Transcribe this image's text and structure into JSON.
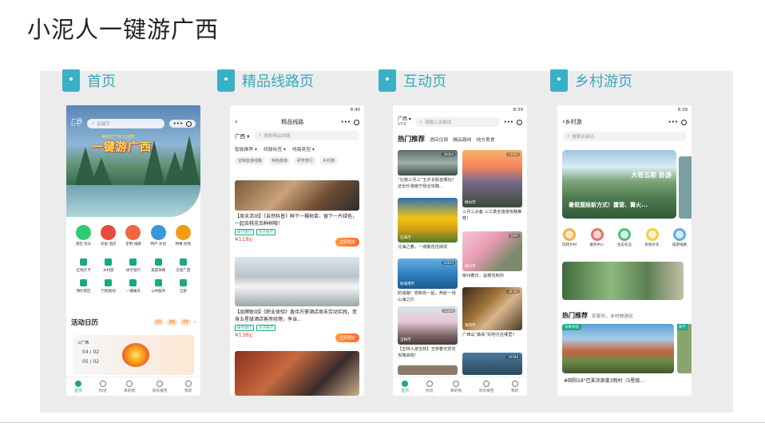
{
  "slide_title": "小泥人一键游广西",
  "section_labels": [
    "首页",
    "精品线路页",
    "互动页",
    "乡村游页"
  ],
  "status_bar": {
    "p2_time": "8:40",
    "p3_time": "8:39",
    "p4_time": "8:39"
  },
  "tabbar": [
    "首页",
    "附近",
    "目的地",
    "资讯报告",
    "我的"
  ],
  "home": {
    "city": "广西",
    "temp": "17°C",
    "search_placeholder": "关键字",
    "hero_sub": "美好的广西 欢迎您",
    "hero_slogan": "一键游广西",
    "main_icons": [
      "景区·玩乐",
      "民宿·酒店",
      "定制·线路",
      "特产·文创",
      "特惠·抢购"
    ],
    "main_icon_colors": [
      "#2ecc71",
      "#e74c3c",
      "#f06543",
      "#3498db",
      "#f39c12"
    ],
    "sub_icons": [
      "红色打卡",
      "乡村游",
      "研学旅行",
      "旅游攻略",
      "云游广西",
      "預约景区",
      "行程规划",
      "一键报车",
      "公共服务",
      "全部"
    ],
    "calendar_title": "活动日历",
    "calendar_days": [
      "22",
      "36",
      "73"
    ],
    "banner_location": "广西",
    "banner_date1": "04 / 02",
    "banner_date2": "05 / 02"
  },
  "routes": {
    "nav_title": "精品线路",
    "city": "广西",
    "search_placeholder": "搜索精品线路",
    "filters": [
      "智能推荐",
      "线路标签",
      "线路类型"
    ],
    "chips": [
      "定制旅游线路",
      "特色旅游",
      "研学旅行",
      "乡村游"
    ],
    "cards": [
      {
        "title": "【周末活动】《自然科普》种下一棵树苗，留下一片绿色，一起去桃花岛种树哦！",
        "badges": [
          "研学旅行",
          "亲子研学"
        ],
        "price": "118",
        "price_unit": "起",
        "button": "立即预定",
        "img_loc": "南宁市"
      },
      {
        "title": "【品牌联动】《职业体验》鑫伟万豪酒店周末劳动实践，变身五星级酒店客房经理，争当...",
        "badges": [
          "研学旅行",
          "亲子研学"
        ],
        "price": "138",
        "price_unit": "起",
        "button": "立即预定",
        "img_loc": "南宁市"
      },
      {
        "title": "",
        "badges": [],
        "price": "",
        "price_unit": "",
        "button": "",
        "img_loc": "南宁市"
      }
    ],
    "currency": "¥"
  },
  "interactive": {
    "city": "广西",
    "temp": "17°C",
    "search_placeholder": "请输入关键词",
    "tab_main": "热门推荐",
    "tabs": [
      "酒店住宿",
      "精品路线",
      "地方美食"
    ],
    "left_col": [
      {
        "views": "30064",
        "loc": "",
        "caption": "“壮族三月三”五天长假去哪玩？这份乐游南宁绿全攻略..."
      },
      {
        "views": "",
        "loc": "北海市",
        "caption": "北海之春，一城繁花任徜徉"
      },
      {
        "views": "21813",
        "loc": "防城港市",
        "caption": "防城港！想和你一起，奔赴一场山海之约"
      },
      {
        "views": "12200",
        "loc": "玉林市",
        "caption": "【玉林人游玉林】玉林春天赏花攻略来啦！"
      },
      {
        "views": "",
        "loc": "",
        "caption": ""
      }
    ],
    "right_col": [
      {
        "views": "23905",
        "loc": "柳州市",
        "caption": "三月三必备 三江县全旅游攻略推荐！"
      },
      {
        "views": "1600",
        "loc": "柳州市",
        "caption": "柳州春日，是樱花和你"
      },
      {
        "views": "28782",
        "loc": "来宾市",
        "caption": "广西岛“森系”的地方在哪里？"
      },
      {
        "views": "40588",
        "loc": "",
        "caption": ""
      }
    ]
  },
  "rural": {
    "nav_title": "乡村游",
    "search_placeholder": "搜索关键词",
    "hero_title": "大苍五彩 卧游",
    "hero_slogan": "暑假遛娃新方式！露营、篝火...",
    "icons": [
      "玩转乡村",
      "服务中心",
      "生态农业",
      "民俗文化",
      "旅游线路"
    ],
    "icon_colors": [
      "#f5b041",
      "#ec7063",
      "#52be80",
      "#f4d03f",
      "#5dade2"
    ],
    "hot_title": "热门推荐",
    "hot_sub": "农家乐、乡村旅游区",
    "card_badge": "农家体验",
    "card_side_badge": "研学",
    "card_caption": "#田阳18°巴某凉泉度3假村（5星级..."
  }
}
